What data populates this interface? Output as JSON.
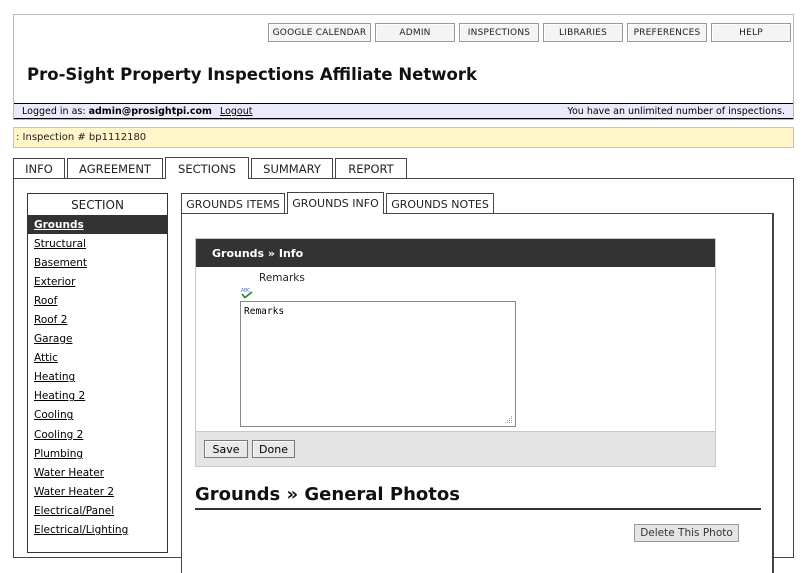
{
  "nav": {
    "items": [
      "GOOGLE CALENDAR",
      "ADMIN",
      "INSPECTIONS",
      "LIBRARIES",
      "PREFERENCES",
      "HELP"
    ]
  },
  "site": {
    "title": "Pro-Sight Property Inspections Affiliate Network"
  },
  "login": {
    "prefix": "Logged in as: ",
    "user": "admin@prosightpi.com",
    "logout_label": "Logout",
    "status": "You have an unlimited number of inspections."
  },
  "inspection": {
    "label": ": Inspection # bp1112180"
  },
  "main_tabs": [
    "INFO",
    "AGREEMENT",
    "SECTIONS",
    "SUMMARY",
    "REPORT"
  ],
  "sections": {
    "header": "SECTION",
    "items": [
      "Grounds",
      "Structural",
      "Basement",
      "Exterior",
      "Roof",
      "Roof 2",
      "Garage",
      "Attic",
      "Heating",
      "Heating 2",
      "Cooling",
      "Cooling 2",
      "Plumbing",
      "Water Heater",
      "Water Heater 2",
      "Electrical/Panel",
      "Electrical/Lighting"
    ]
  },
  "sub_tabs": [
    "GROUNDS ITEMS",
    "GROUNDS INFO",
    "GROUNDS NOTES"
  ],
  "info": {
    "title": "Grounds » Info",
    "remarks_label": "Remarks",
    "remarks_value": "Remarks",
    "save_label": "Save",
    "done_label": "Done"
  },
  "photos": {
    "heading": "Grounds » General Photos",
    "delete_label": "Delete This Photo"
  },
  "colors": {
    "dark_header": "#333333",
    "inspection_bar": "#fff5c8",
    "login_bar": "#e9ebfa"
  }
}
